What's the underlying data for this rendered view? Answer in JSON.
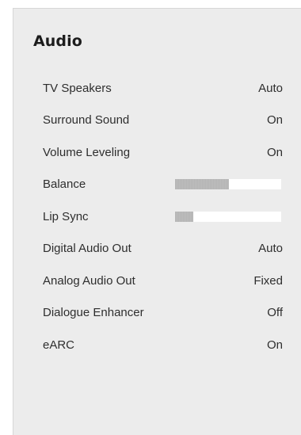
{
  "title": "Audio",
  "items": [
    {
      "label": "TV Speakers",
      "value": "Auto"
    },
    {
      "label": "Surround Sound",
      "value": "On"
    },
    {
      "label": "Volume Leveling",
      "value": "On"
    },
    {
      "label": "Balance",
      "level": 0.51
    },
    {
      "label": "Lip Sync",
      "level": 0.17
    },
    {
      "label": "Digital Audio Out",
      "value": "Auto"
    },
    {
      "label": "Analog Audio Out",
      "value": "Fixed"
    },
    {
      "label": "Dialogue Enhancer",
      "value": "Off"
    },
    {
      "label": "eARC",
      "value": "On"
    }
  ],
  "colors": {
    "panel_background": "#ececec",
    "slider_track": "#ffffff",
    "slider_fill": "#b8b8b8",
    "text": "#2e2e2e"
  }
}
